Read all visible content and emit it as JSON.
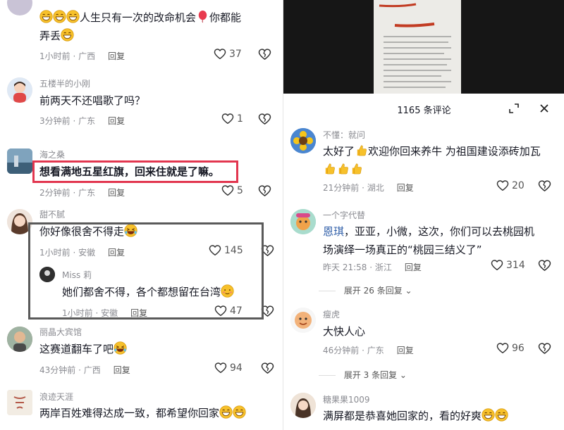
{
  "left_panel": {
    "comments": [
      {
        "name": "",
        "text_line1": "人生只有一次的改命机会",
        "text_line1_tail": "你都能",
        "text_line2": "弄丢",
        "time": "1小时前 · 广西",
        "reply": "回复",
        "likes": "37"
      },
      {
        "name": "五楼半的小刚",
        "text": "前两天不还唱歌了吗？",
        "time": "3分钟前 · 广东",
        "reply": "回复",
        "likes": "1"
      },
      {
        "name": "海之桑",
        "text": "想看满地五星红旗，回来住就是了嘛。",
        "time": "2分钟前 · 广东",
        "reply": "回复",
        "likes": "5"
      },
      {
        "name": "甜不腻",
        "text": "你好像很舍不得走",
        "time": "1小时前 · 安徽",
        "reply": "回复",
        "likes": "145"
      },
      {
        "name": "Miss 莉",
        "text": "她们都舍不得，各个都想留在台湾",
        "time": "1小时前 · 安徽",
        "reply": "回复",
        "likes": "47"
      },
      {
        "name": "丽晶大宾馆",
        "text": "这赛道翻车了吧",
        "time": "43分钟前 · 广西",
        "reply": "回复",
        "likes": "94"
      },
      {
        "name": "浪迹天涯",
        "text": "两岸百姓难得达成一致，都希望你回家"
      }
    ]
  },
  "right_panel": {
    "header": {
      "title": "1165 条评论"
    },
    "comments": [
      {
        "name": "不懂：就问",
        "text_line1": "太好了",
        "text_line1_tail": "欢迎你回来养牛  为祖国建设添砖加瓦",
        "time": "21分钟前 · 湖北",
        "reply": "回复",
        "likes": "20"
      },
      {
        "name": "一个字代替",
        "text_line1_name": "恩琪",
        "text_line1": "，亚亚，小微，这次，你们可以去桃园机",
        "text_line2": "场演绎一场真正的“桃园三结义了”",
        "time": "昨天 21:58 · 浙江",
        "reply": "回复",
        "likes": "314",
        "expand": "展开 26 条回复"
      },
      {
        "name": "瘦虎",
        "text": "大快人心",
        "time": "46分钟前 · 广东",
        "reply": "回复",
        "likes": "96",
        "expand": "展开 3 条回复"
      },
      {
        "name": "糖果果1009",
        "text": "满屏都是恭喜她回家的，看的好爽"
      }
    ]
  },
  "colors": {
    "highlight_red": "#e2364f",
    "highlight_gray": "#5a5a5a",
    "emoji_yellow": "#f7c12b"
  }
}
